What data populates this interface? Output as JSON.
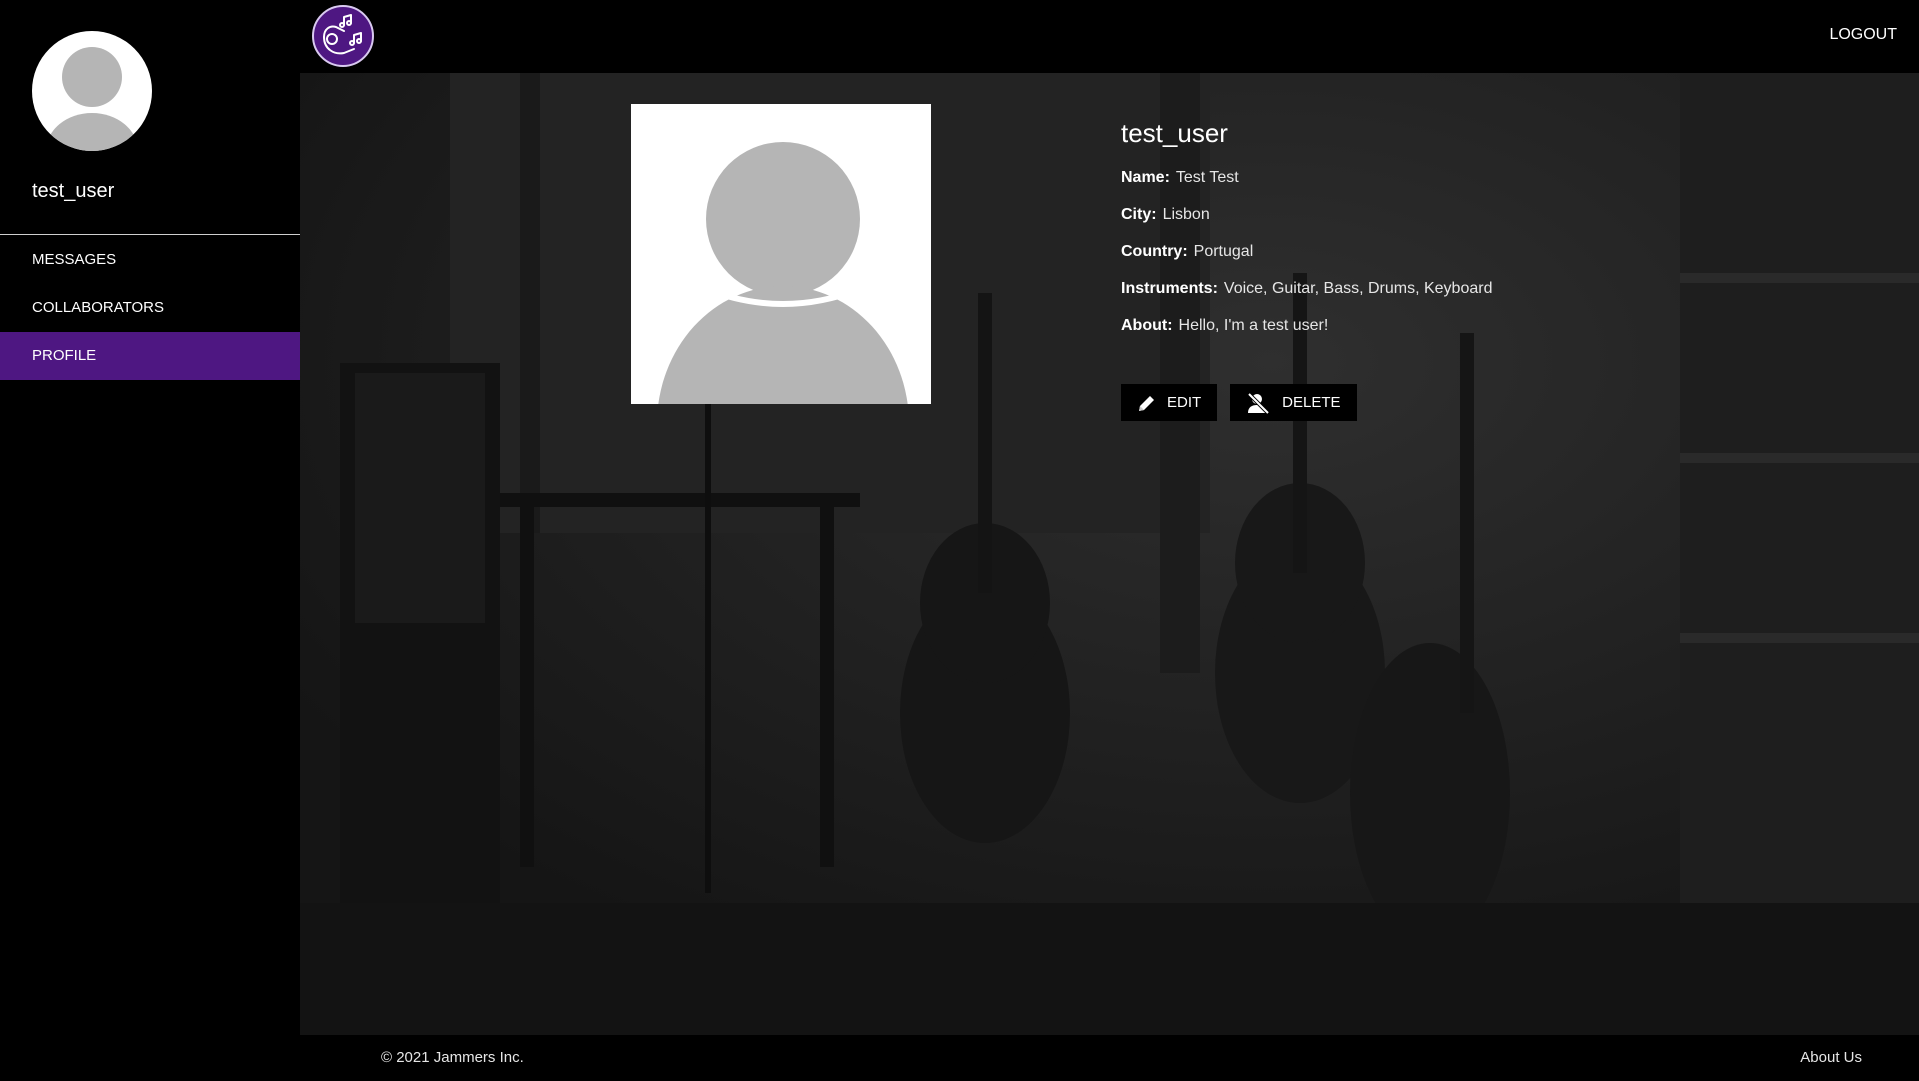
{
  "sidebar": {
    "username": "test_user",
    "items": [
      {
        "label": "MESSAGES",
        "active": false
      },
      {
        "label": "COLLABORATORS",
        "active": false
      },
      {
        "label": "PROFILE",
        "active": true
      }
    ]
  },
  "topbar": {
    "logo_icon": "hand-music-notes-icon",
    "logout_label": "LOGOUT"
  },
  "profile": {
    "title": "test_user",
    "fields": [
      {
        "label": "Name:",
        "value": "Test Test"
      },
      {
        "label": "City:",
        "value": "Lisbon"
      },
      {
        "label": "Country:",
        "value": "Portugal"
      },
      {
        "label": "Instruments:",
        "value": "Voice, Guitar, Bass, Drums, Keyboard"
      },
      {
        "label": "About:",
        "value": "Hello, I'm a test user!"
      }
    ],
    "edit_label": "EDIT",
    "delete_label": "DELETE"
  },
  "footer": {
    "copyright": "© 2021 Jammers Inc.",
    "about_label": "About Us"
  },
  "colors": {
    "accent": "#4e1782",
    "background": "#000000",
    "avatar_placeholder": "#b5b5b5"
  }
}
